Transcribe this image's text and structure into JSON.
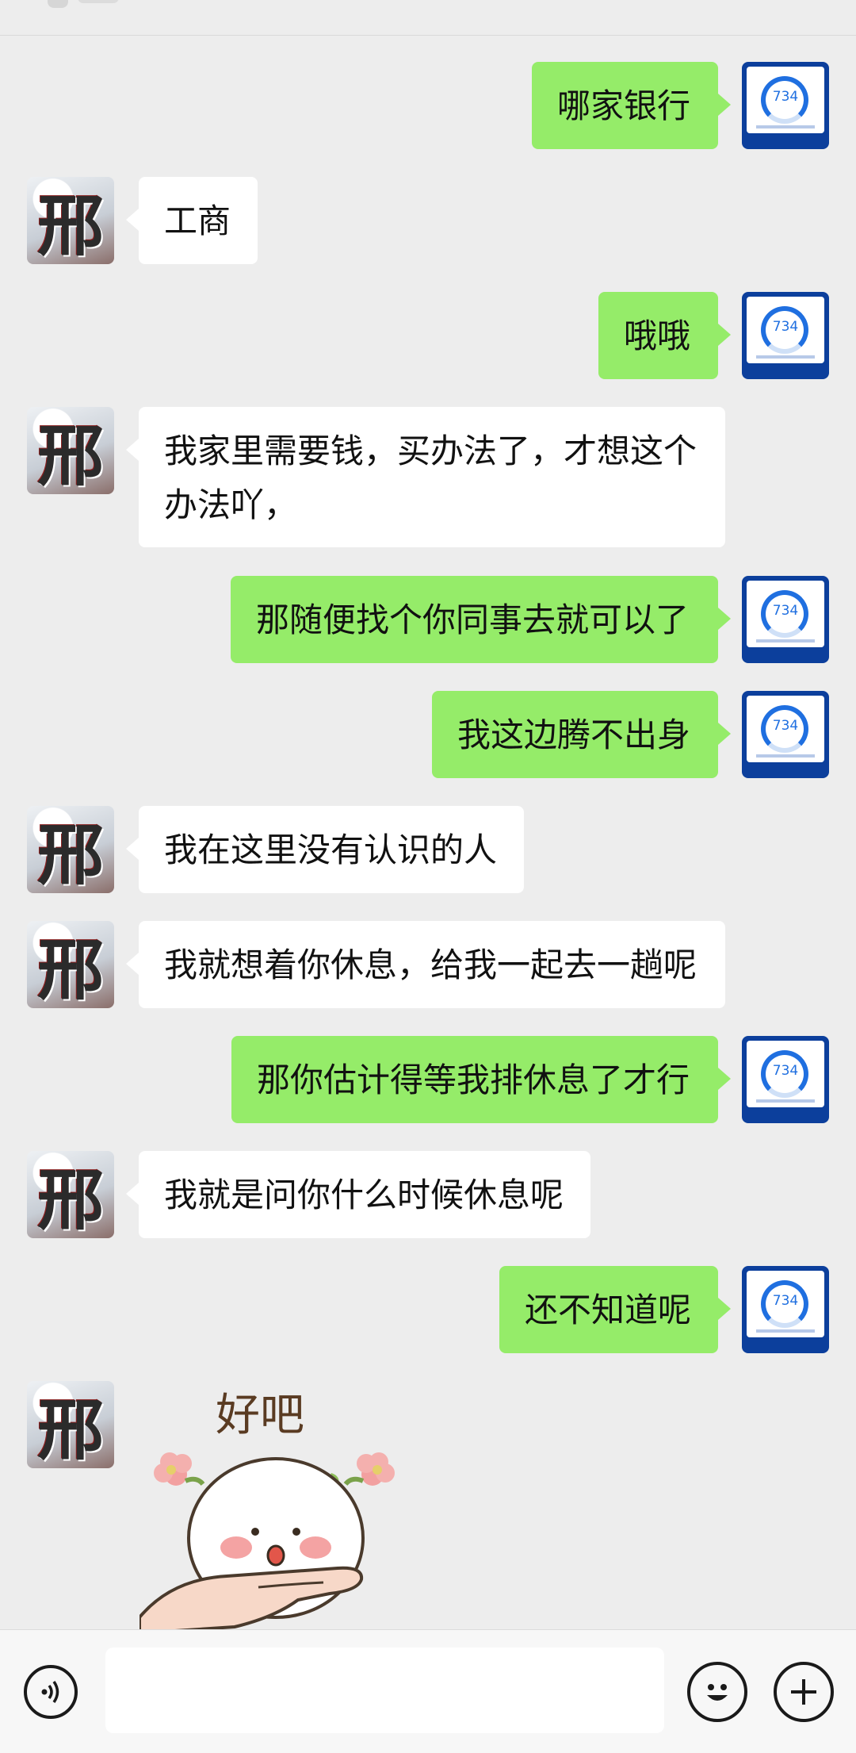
{
  "composer": {
    "input_value": "",
    "voice_icon": "voice-icon",
    "emoji_icon": "emoji-icon",
    "plus_icon": "plus-icon"
  },
  "avatars": {
    "other_glyph": "邢",
    "me_score": "734"
  },
  "messages": [
    {
      "side": "right",
      "text": "哪家银行"
    },
    {
      "side": "left",
      "text": "工商"
    },
    {
      "side": "right",
      "text": "哦哦"
    },
    {
      "side": "left",
      "text": "我家里需要钱，买办法了，才想这个办法吖，"
    },
    {
      "side": "right",
      "text": "那随便找个你同事去就可以了"
    },
    {
      "side": "right",
      "text": "我这边腾不出身"
    },
    {
      "side": "left",
      "text": "我在这里没有认识的人"
    },
    {
      "side": "left",
      "text": "我就想着你休息，给我一起去一趟呢"
    },
    {
      "side": "right",
      "text": "那你估计得等我排休息了才行"
    },
    {
      "side": "left",
      "text": "我就是问你什么时候休息呢"
    },
    {
      "side": "right",
      "text": "还不知道呢"
    }
  ],
  "sticker": {
    "side": "left",
    "caption": "好吧"
  }
}
